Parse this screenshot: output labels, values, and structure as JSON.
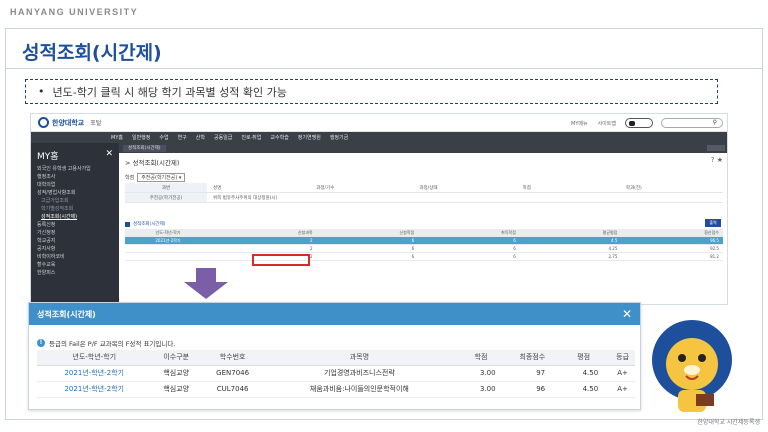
{
  "header": {
    "university": "HANYANG UNIVERSITY"
  },
  "slide": {
    "title": "성적조회(시간제)",
    "note": "년도-학기 클릭 시 해당 학기 과목별 성적 확인 가능",
    "credit": "한양대학교 시간제등록생"
  },
  "portal": {
    "logo": "한양대학교",
    "logo_sub": "포털",
    "top_links": [
      "MY메뉴",
      "사이트맵"
    ],
    "nav": [
      "MY홈",
      "일반행정",
      "수업",
      "연구",
      "산학",
      "공동일급",
      "진로·취업",
      "교수학습",
      "정기연맹원",
      "행정기금"
    ],
    "sidebar_title": "MY홈",
    "sidebar": [
      "외국인 유학생 고용사가입",
      "행정조사",
      "대학의업",
      "성적/영업사항조회",
      "고급가입조회",
      "학기별성적조회",
      "성적조회(시간제)",
      "등록신청",
      "가신청정",
      "학교공지",
      "공지사항",
      "비학이하코비",
      "할수교육",
      "한양피스"
    ],
    "tab": "성적조회(시간제)",
    "page_title": "성적조회(시간제)",
    "select_label": "학점",
    "select_value": "주전공(학기전공)",
    "form": [
      {
        "label": "과번",
        "cells": [
          "성명",
          "과정/기수",
          "과정/상태",
          "학점",
          "학과(전)"
        ]
      },
      {
        "label": "주전공(학기전공)",
        "cells": [
          "위쪽 법유주사주위의 대상정원(시)"
        ]
      }
    ],
    "section_title": "성적조회(시간제)",
    "view_button": "출력",
    "grid_head": [
      "년도-학년-학기",
      "신청과목",
      "신청학점",
      "취득학점",
      "평균평점",
      "환산점수"
    ],
    "grid_rows": [
      [
        "2021년-2학기",
        "2",
        "6",
        "6",
        "4.5",
        "96.5"
      ],
      [
        "",
        "2",
        "6",
        "6",
        "4.25",
        "92.5"
      ],
      [
        "",
        "2",
        "6",
        "6",
        "2.75",
        "81.2"
      ]
    ]
  },
  "popup": {
    "title": "성적조회(시간제)",
    "note": "등급의 Fail은 P/F 교과목의 F성적 표기입니다.",
    "columns": [
      "년도-학년-학기",
      "이수구분",
      "학수번호",
      "과목명",
      "학점",
      "최종점수",
      "평점",
      "등급"
    ],
    "rows": [
      [
        "2021년-학년-2학기",
        "핵심교양",
        "GEN7046",
        "기업경영과비즈니스전략",
        "3.00",
        "97",
        "4.50",
        "A+"
      ],
      [
        "2021년-학년-2학기",
        "핵심교양",
        "CUL7046",
        "채움과비움:나이듦의인문학적이해",
        "3.00",
        "96",
        "4.50",
        "A+"
      ]
    ]
  },
  "colors": {
    "accent": "#1e4f9c",
    "popup_header": "#3f8fc9",
    "highlight": "#d62b2b",
    "arrow": "#7a5fa8"
  }
}
